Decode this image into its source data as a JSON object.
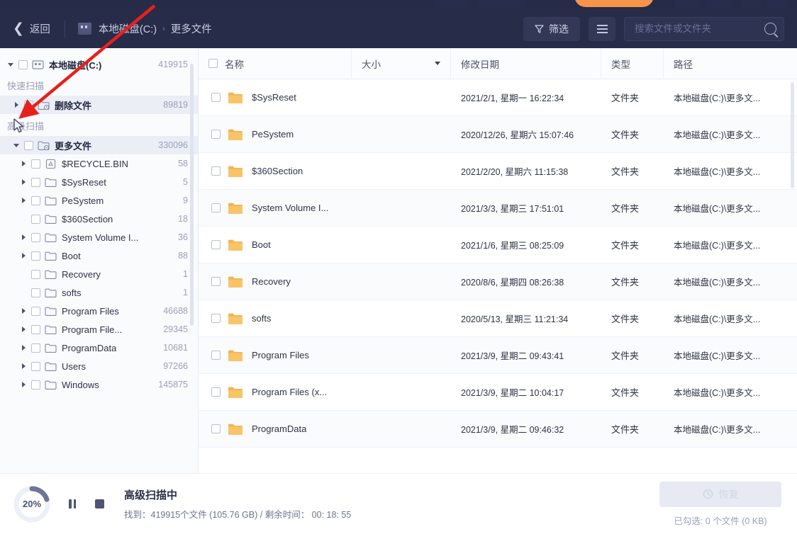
{
  "header": {
    "back_label": "返回",
    "drive_icon": "drive-icon",
    "breadcrumb": [
      {
        "label": "本地磁盘(C:)"
      },
      {
        "label": "更多文件"
      }
    ],
    "breadcrumb_separator": "›",
    "filter_label": "筛选",
    "filter_icon": "funnel-icon",
    "list_view_icon": "list-view-icon",
    "search": {
      "placeholder": "搜索文件或文件夹",
      "value": "",
      "icon": "search-icon"
    }
  },
  "sidebar": {
    "root": {
      "label": "本地磁盘(C:)",
      "count": "419915",
      "expanded": true,
      "icon": "drive-icon"
    },
    "sections": [
      {
        "label": "快速扫描"
      },
      {
        "label": "高级扫描"
      }
    ],
    "items": [
      {
        "label": "删除文件",
        "count": "89819",
        "level": 1,
        "arrow": "right",
        "icon": "folder-deleted-icon",
        "bold": true,
        "selected": true
      },
      {
        "label": "更多文件",
        "count": "330096",
        "level": 1,
        "arrow": "down",
        "icon": "folder-more-icon",
        "bold": true,
        "selected": true
      },
      {
        "label": "$RECYCLE.BIN",
        "count": "58",
        "level": 2,
        "arrow": "right",
        "icon": "recycle-bin-icon"
      },
      {
        "label": "$SysReset",
        "count": "5",
        "level": 2,
        "arrow": "right",
        "icon": "folder-icon"
      },
      {
        "label": "PeSystem",
        "count": "9",
        "level": 2,
        "arrow": "right",
        "icon": "folder-icon"
      },
      {
        "label": "$360Section",
        "count": "18",
        "level": 2,
        "arrow": "none",
        "icon": "folder-icon"
      },
      {
        "label": "System Volume I...",
        "count": "36",
        "level": 2,
        "arrow": "right",
        "icon": "folder-icon"
      },
      {
        "label": "Boot",
        "count": "88",
        "level": 2,
        "arrow": "right",
        "icon": "folder-icon"
      },
      {
        "label": "Recovery",
        "count": "1",
        "level": 2,
        "arrow": "none",
        "icon": "folder-icon"
      },
      {
        "label": "softs",
        "count": "1",
        "level": 2,
        "arrow": "none",
        "icon": "folder-icon"
      },
      {
        "label": "Program Files",
        "count": "46688",
        "level": 2,
        "arrow": "right",
        "icon": "folder-icon"
      },
      {
        "label": "Program File...",
        "count": "29345",
        "level": 2,
        "arrow": "right",
        "icon": "folder-icon"
      },
      {
        "label": "ProgramData",
        "count": "10681",
        "level": 2,
        "arrow": "right",
        "icon": "folder-icon"
      },
      {
        "label": "Users",
        "count": "97266",
        "level": 2,
        "arrow": "right",
        "icon": "folder-icon"
      },
      {
        "label": "Windows",
        "count": "145875",
        "level": 2,
        "arrow": "right",
        "icon": "folder-icon"
      }
    ]
  },
  "table": {
    "columns": [
      {
        "key": "name",
        "label": "名称"
      },
      {
        "key": "size",
        "label": "大小"
      },
      {
        "key": "date",
        "label": "修改日期"
      },
      {
        "key": "type",
        "label": "类型"
      },
      {
        "key": "path",
        "label": "路径"
      }
    ],
    "sort_indicator_column": "大小",
    "rows": [
      {
        "name": "$SysReset",
        "size": "",
        "date": "2021/2/1, 星期一 16:22:34",
        "type": "文件夹",
        "path": "本地磁盘(C:)\\更多文..."
      },
      {
        "name": "PeSystem",
        "size": "",
        "date": "2020/12/26, 星期六 15:07:46",
        "type": "文件夹",
        "path": "本地磁盘(C:)\\更多文..."
      },
      {
        "name": "$360Section",
        "size": "",
        "date": "2021/2/20, 星期六 11:15:38",
        "type": "文件夹",
        "path": "本地磁盘(C:)\\更多文..."
      },
      {
        "name": "System Volume I...",
        "size": "",
        "date": "2021/3/3, 星期三 17:51:01",
        "type": "文件夹",
        "path": "本地磁盘(C:)\\更多文..."
      },
      {
        "name": "Boot",
        "size": "",
        "date": "2021/1/6, 星期三 08:25:09",
        "type": "文件夹",
        "path": "本地磁盘(C:)\\更多文..."
      },
      {
        "name": "Recovery",
        "size": "",
        "date": "2020/8/6, 星期四 08:26:38",
        "type": "文件夹",
        "path": "本地磁盘(C:)\\更多文..."
      },
      {
        "name": "softs",
        "size": "",
        "date": "2020/5/13, 星期三 11:21:34",
        "type": "文件夹",
        "path": "本地磁盘(C:)\\更多文..."
      },
      {
        "name": "Program Files",
        "size": "",
        "date": "2021/3/9, 星期二 09:43:41",
        "type": "文件夹",
        "path": "本地磁盘(C:)\\更多文..."
      },
      {
        "name": "Program Files (x...",
        "size": "",
        "date": "2021/3/9, 星期二 10:04:17",
        "type": "文件夹",
        "path": "本地磁盘(C:)\\更多文..."
      },
      {
        "name": "ProgramData",
        "size": "",
        "date": "2021/3/9, 星期二 09:46:32",
        "type": "文件夹",
        "path": "本地磁盘(C:)\\更多文..."
      }
    ]
  },
  "footer": {
    "progress_percent": "20%",
    "pause_icon": "pause-icon",
    "stop_icon": "stop-icon",
    "status_title": "高级扫描中",
    "status_detail": "找到：419915个文件 (105.76 GB) / 剩余时间： 00: 18: 55",
    "restore_label": "恢复",
    "restore_icon": "restore-clock-icon",
    "selection_text": "已勾选: 0 个文件 (0 KB)"
  },
  "annotation": {
    "arrow_color": "#e8201c",
    "arrow_name": "red-pointer-arrow"
  },
  "colors": {
    "header_bg": "#272c49",
    "accent_orange": "#f5944a",
    "folder_yellow": "#f5b859",
    "sidebar_bg": "#fafbfd"
  }
}
